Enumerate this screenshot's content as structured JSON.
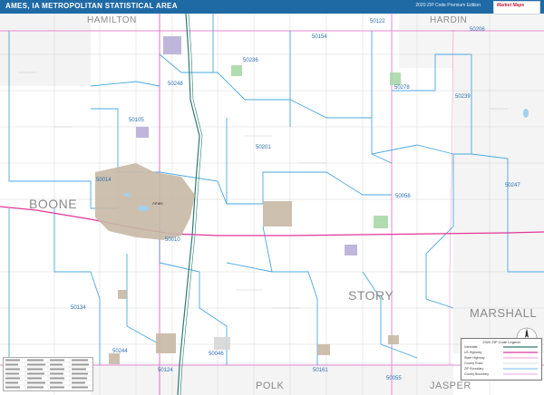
{
  "header": {
    "title": "AMES, IA METROPOLITAN STATISTICAL AREA",
    "edition": "2020 ZIP Code Premium Edition",
    "logo_text": "Market Maps"
  },
  "counties": [
    {
      "id": "hamilton",
      "name": "HAMILTON"
    },
    {
      "id": "hardin",
      "name": "HARDIN"
    },
    {
      "id": "boone",
      "name": "BOONE"
    },
    {
      "id": "story",
      "name": "STORY"
    },
    {
      "id": "marshall",
      "name": "MARSHALL"
    },
    {
      "id": "polk",
      "name": "POLK"
    },
    {
      "id": "jasper",
      "name": "JASPER"
    }
  ],
  "zips": [
    {
      "id": "z50154",
      "code": "50154"
    },
    {
      "id": "z50122",
      "code": "50122"
    },
    {
      "id": "z50206",
      "code": "50206"
    },
    {
      "id": "z50236",
      "code": "50236"
    },
    {
      "id": "z50248",
      "code": "50248"
    },
    {
      "id": "z50278",
      "code": "50278"
    },
    {
      "id": "z50239",
      "code": "50239"
    },
    {
      "id": "z50105",
      "code": "50105"
    },
    {
      "id": "z50201",
      "code": "50201"
    },
    {
      "id": "z50014",
      "code": "50014"
    },
    {
      "id": "z50056",
      "code": "50056"
    },
    {
      "id": "z50247",
      "code": "50247"
    },
    {
      "id": "z50010",
      "code": "50010"
    },
    {
      "id": "z50134",
      "code": "50134"
    },
    {
      "id": "z50244",
      "code": "50244"
    },
    {
      "id": "z50124",
      "code": "50124"
    },
    {
      "id": "z50046",
      "code": "50046"
    },
    {
      "id": "z50161",
      "code": "50161"
    },
    {
      "id": "z50055",
      "code": "50055"
    }
  ],
  "cities": [
    {
      "id": "ames",
      "name": "Ames"
    }
  ],
  "legend": {
    "title": "2020 ZIP Code Legend",
    "rows": [
      "Interstate",
      "US Highway",
      "State Highway",
      "County Road",
      "ZIP Boundary",
      "County Boundary"
    ]
  },
  "compass": {
    "label": "N"
  },
  "colors": {
    "zip_boundary": "#4aa8e0",
    "county_boundary": "#e58ad4",
    "highway": "#e2369a",
    "interstate": "#2e7b6f",
    "title_bar": "#1f6aa5",
    "urban": "#c8b9a6"
  }
}
